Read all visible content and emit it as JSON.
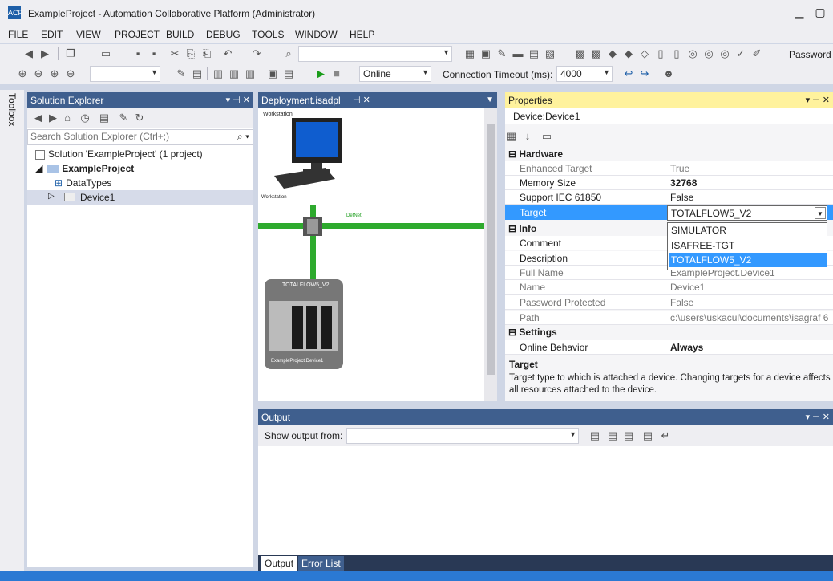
{
  "window": {
    "title": "ExampleProject - Automation Collaborative Platform (Administrator)",
    "app_icon": "ACP"
  },
  "menu": [
    "FILE",
    "EDIT",
    "VIEW",
    "PROJECT",
    "BUILD",
    "DEBUG",
    "TOOLS",
    "WINDOW",
    "HELP"
  ],
  "toolbar": {
    "password_label": "Password",
    "mode_value": "Online",
    "timeout_label": "Connection Timeout (ms):",
    "timeout_value": "4000"
  },
  "toolbox": {
    "label": "Toolbox"
  },
  "solution_explorer": {
    "title": "Solution Explorer",
    "search_placeholder": "Search Solution Explorer (Ctrl+;)",
    "solution": "Solution 'ExampleProject' (1 project)",
    "project": "ExampleProject",
    "items": [
      "DataTypes",
      "Device1"
    ]
  },
  "deployment": {
    "tab": "Deployment.isadpl",
    "workstation_top": "Workstation",
    "workstation_label": "Workstation",
    "network_label": "DefNet",
    "device_title": "TOTALFLOW5_V2",
    "device_name": "ExampleProject.Device1"
  },
  "properties": {
    "title": "Properties",
    "object": "Device:Device1",
    "categories": {
      "hardware": "Hardware",
      "info": "Info",
      "settings": "Settings"
    },
    "hardware": [
      {
        "name": "Enhanced Target",
        "value": "True"
      },
      {
        "name": "Memory Size",
        "value": "32768"
      },
      {
        "name": "Support IEC 61850",
        "value": "False"
      },
      {
        "name": "Target",
        "value": "TOTALFLOW5_V2"
      }
    ],
    "info": [
      {
        "name": "Comment",
        "value": ""
      },
      {
        "name": "Description",
        "value": ""
      },
      {
        "name": "Full Name",
        "value": "ExampleProject.Device1"
      },
      {
        "name": "Name",
        "value": "Device1"
      },
      {
        "name": "Password Protected",
        "value": "False"
      },
      {
        "name": "Path",
        "value": "c:\\users\\uskacul\\documents\\isagraf 6"
      }
    ],
    "settings": [
      {
        "name": "Online Behavior",
        "value": "Always"
      }
    ],
    "dropdown_options": [
      "SIMULATOR",
      "ISAFREE-TGT",
      "TOTALFLOW5_V2"
    ],
    "desc_title": "Target",
    "desc_text": "Target type to which is attached a device. Changing targets for a device affects all resources attached to the device."
  },
  "output": {
    "title": "Output",
    "show_from": "Show output from:",
    "tabs": [
      "Output",
      "Error List"
    ]
  },
  "colors": {
    "accent": "#3f5f8e",
    "properties_header": "#fff29d",
    "selection": "#3399ff",
    "status": "#2b79d3"
  }
}
